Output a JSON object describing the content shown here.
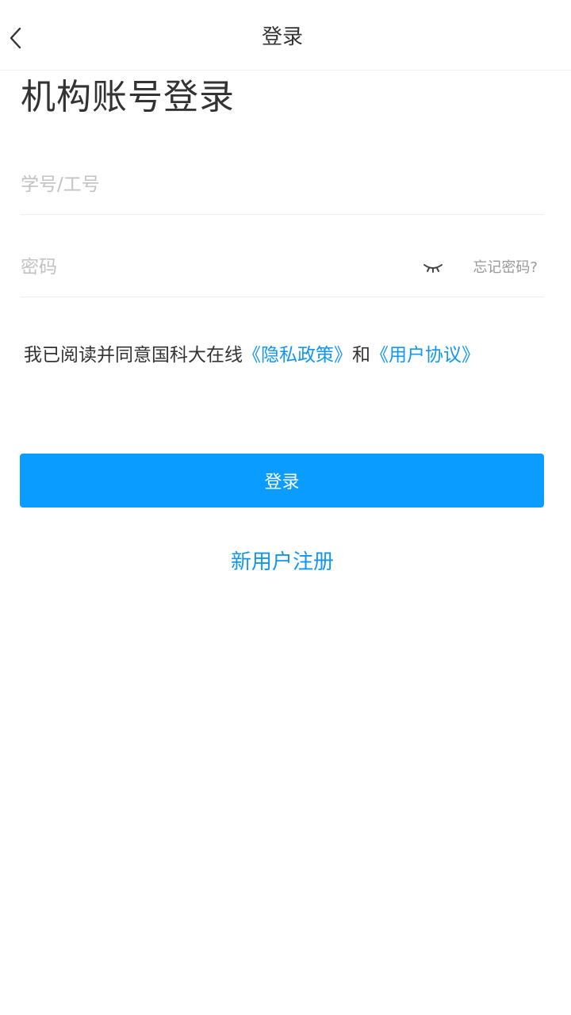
{
  "nav": {
    "title": "登录"
  },
  "heading": "机构账号登录",
  "form": {
    "account_placeholder": "学号/工号",
    "account_value": "",
    "password_placeholder": "密码",
    "password_value": "",
    "forgot_label": "忘记密码?"
  },
  "agreement": {
    "prefix": "我已阅读并同意国科大在线",
    "privacy_label": "《隐私政策》",
    "joiner": "和",
    "terms_label": "《用户协议》"
  },
  "login_button": "登录",
  "register_link": "新用户注册",
  "colors": {
    "accent": "#0a9cff",
    "link": "#1296f3",
    "text": "#333333",
    "placeholder": "#c2c2c2",
    "muted": "#999999",
    "divider": "#eeeeee"
  },
  "icons": {
    "back": "chevron-left-icon",
    "password_visibility": "eye-closed-icon"
  }
}
